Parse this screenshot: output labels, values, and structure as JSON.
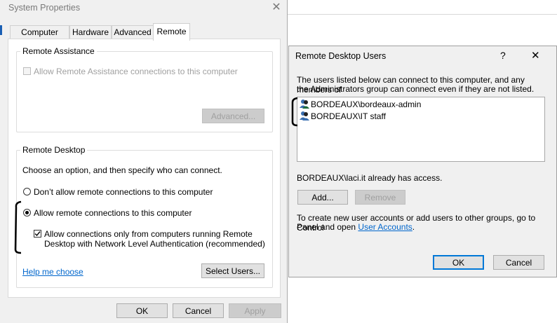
{
  "system_properties": {
    "title": "System Properties",
    "tabs": [
      {
        "label": "Computer Name"
      },
      {
        "label": "Hardware"
      },
      {
        "label": "Advanced"
      },
      {
        "label": "Remote"
      }
    ],
    "remote_assistance": {
      "group_title": "Remote Assistance",
      "allow_label": "Allow Remote Assistance connections to this computer",
      "advanced_button": "Advanced..."
    },
    "remote_desktop": {
      "group_title": "Remote Desktop",
      "instruction": "Choose an option, and then specify who can connect.",
      "option_dont_allow": "Don’t allow remote connections to this computer",
      "option_allow": "Allow remote connections to this computer",
      "nla_line1": "Allow connections only from computers running Remote",
      "nla_line2": "Desktop with Network Level Authentication (recommended)",
      "help_link": "Help me choose",
      "select_users_button": "Select Users..."
    },
    "buttons": {
      "ok": "OK",
      "cancel": "Cancel",
      "apply": "Apply"
    }
  },
  "rdu_dialog": {
    "title": "Remote Desktop Users",
    "help_glyph": "?",
    "description_line1": "The users listed below can connect to this computer, and any members of",
    "description_line2": "the Administrators group can connect even if they are not listed.",
    "users": [
      {
        "name": "BORDEAUX\\bordeaux-admin"
      },
      {
        "name": "BORDEAUX\\IT staff"
      }
    ],
    "access_note": "BORDEAUX\\laci.it already has access.",
    "add_button": "Add...",
    "remove_button": "Remove",
    "info_line1": "To create new user accounts or add users to other groups, go to Control",
    "info_line2_prefix": "Panel and open ",
    "info_link": "User Accounts",
    "info_line2_suffix": ".",
    "ok_button": "OK",
    "cancel_button": "Cancel"
  },
  "colors": {
    "accent": "#0078d7",
    "link": "#0066cc",
    "dialog_bg": "#f0f0f0"
  },
  "icons": [
    "close-icon",
    "help-icon",
    "user-group-icon",
    "checkmark-icon"
  ]
}
